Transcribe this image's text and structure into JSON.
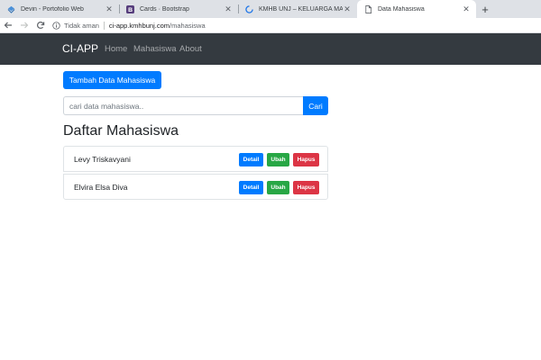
{
  "browser": {
    "tabs": [
      {
        "title": "Devin - Portofolio Web",
        "icon": "codepen-icon",
        "active": false
      },
      {
        "title": "Cards · Bootstrap",
        "icon": "bootstrap-icon",
        "active": false
      },
      {
        "title": "KMHB UNJ – KELUARGA MAHASISWA",
        "icon": "loading-spinner-icon",
        "active": false
      },
      {
        "title": "Data Mahasiswa",
        "icon": "document-icon",
        "active": true
      }
    ],
    "close_glyph": "✕",
    "new_tab_glyph": "+",
    "address": {
      "security_label": "Tidak aman",
      "host": "ci-app.kmhbunj.com",
      "path": "/mahasiswa"
    }
  },
  "navbar": {
    "brand": "CI-APP",
    "links": [
      "Home",
      "Mahasiswa",
      "About"
    ]
  },
  "main": {
    "add_button": "Tambah Data Mahasiswa",
    "search_placeholder": "cari data mahasiswa..",
    "search_button": "Cari",
    "title": "Daftar Mahasiswa",
    "students": [
      {
        "name": "Levy Triskavyani"
      },
      {
        "name": "Elvira Elsa Diva"
      }
    ],
    "actions": {
      "detail": "Detail",
      "ubah": "Ubah",
      "hapus": "Hapus"
    }
  },
  "colors": {
    "primary": "#007bff",
    "success": "#28a745",
    "danger": "#dc3545",
    "navbar": "#343a40"
  }
}
